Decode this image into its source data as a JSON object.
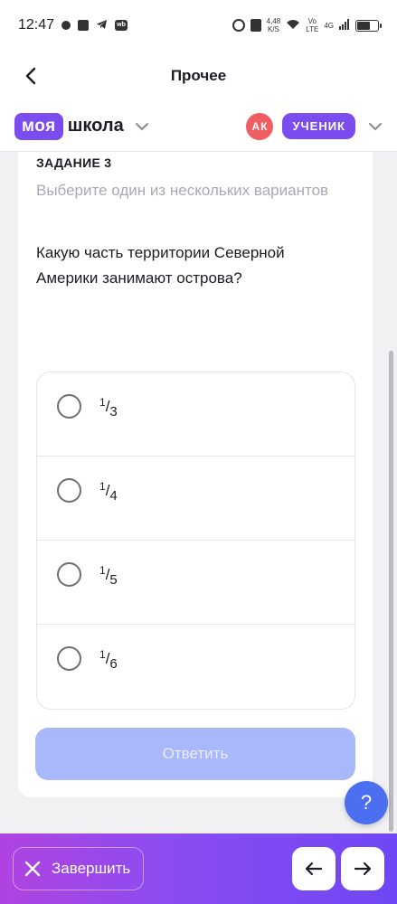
{
  "status_bar": {
    "time": "12:47",
    "speed_top": "4,48",
    "speed_bottom": "K/S",
    "network_top": "Vo",
    "network_bottom": "LTE",
    "signal": "4G",
    "battery": "64"
  },
  "nav": {
    "title": "Прочее"
  },
  "brand": {
    "logo_part1": "моя",
    "logo_part2": "школа",
    "avatar_initials": "АК",
    "role": "УЧЕНИК"
  },
  "task": {
    "label": "ЗАДАНИЕ 3",
    "hint": "Выберите один из нескольких вариантов",
    "question": "Какую часть территории Северной Америки занимают острова?",
    "options": [
      {
        "numerator": "1",
        "denominator": "3"
      },
      {
        "numerator": "1",
        "denominator": "4"
      },
      {
        "numerator": "1",
        "denominator": "5"
      },
      {
        "numerator": "1",
        "denominator": "6"
      }
    ],
    "submit_label": "Ответить"
  },
  "help": {
    "label": "?"
  },
  "bottom": {
    "finish_label": "Завершить"
  },
  "colors": {
    "accent": "#7b4cf0",
    "avatar": "#ef5f62",
    "submit_disabled": "#a9b8fb",
    "help": "#4b6ff0"
  }
}
